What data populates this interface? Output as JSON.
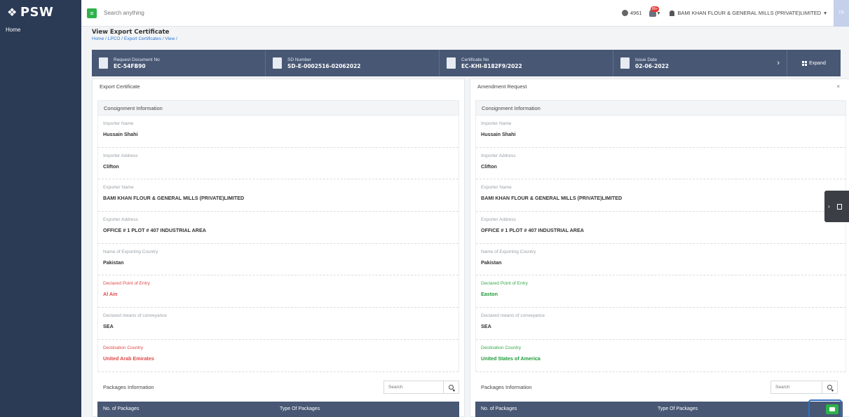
{
  "app": {
    "logo": "PSW",
    "nav_home": "Home"
  },
  "topbar": {
    "search_placeholder": "Search anything",
    "counter": "4961",
    "notification_count": "99+",
    "user_name": "BAMI KHAN FLOUR & GENERAL MILLS (PRIVATE)LIMITED",
    "avatar_initials": "TR"
  },
  "page": {
    "title": "View Export Certificate",
    "breadcrumb": "Home / LPCO / Export Certificates / View /"
  },
  "infobar": {
    "items": [
      {
        "label": "Request Document No",
        "value": "EC-54FB90"
      },
      {
        "label": "SD Number",
        "value": "SD-E-0002516-02062022"
      },
      {
        "label": "Certificate No",
        "value": "EC-KHI-8182F9/2022"
      },
      {
        "label": "Issue Date",
        "value": "02-06-2022"
      }
    ],
    "expand_label": "Expand"
  },
  "left_panel": {
    "title": "Export Certificate",
    "section": "Consignment Information",
    "fields": [
      {
        "label": "Importer Name",
        "value": "Hussain Shahi"
      },
      {
        "label": "Importer Address",
        "value": "Clifton"
      },
      {
        "label": "Exporter Name",
        "value": "BAMI KHAN FLOUR & GENERAL MILLS (PRIVATE)LIMITED"
      },
      {
        "label": "Exporter Address",
        "value": "OFFICE # 1 PLOT # 407 INDUSTRIAL AREA"
      },
      {
        "label": "Name of Exporting Country",
        "value": "Pakistan"
      },
      {
        "label": "Declared Point of Entry",
        "value": "Al Ain"
      },
      {
        "label": "Declared means of conveyance",
        "value": "SEA"
      },
      {
        "label": "Destination Country",
        "value": "United Arab Emirates"
      }
    ],
    "packages_title": "Packages Information",
    "search_placeholder": "Search",
    "columns": [
      "No. of Packages",
      "Type Of Packages"
    ]
  },
  "right_panel": {
    "title": "Amendment Request",
    "close": "×",
    "section": "Consignment Information",
    "fields": [
      {
        "label": "Importer Name",
        "value": "Hussain Shahi"
      },
      {
        "label": "Importer Address",
        "value": "Clifton"
      },
      {
        "label": "Exporter Name",
        "value": "BAMI KHAN FLOUR & GENERAL MILLS (PRIVATE)LIMITED"
      },
      {
        "label": "Exporter Address",
        "value": "OFFICE # 1 PLOT # 407 INDUSTRIAL AREA"
      },
      {
        "label": "Name of Exporting Country",
        "value": "Pakistan"
      },
      {
        "label": "Declared Point of Entry",
        "value": "Easton"
      },
      {
        "label": "Declared means of conveyance",
        "value": "SEA"
      },
      {
        "label": "Destination Country",
        "value": "United States of America"
      }
    ],
    "packages_title": "Packages Information",
    "search_placeholder": "Search",
    "columns": [
      "No. of Packages",
      "Type Of Packages"
    ]
  },
  "colors": {
    "sidebar": "#2b3a55",
    "infobar": "#475774",
    "changed_old": "#e04848",
    "changed_new": "#1f9b3b",
    "accent_green": "#2db24a"
  }
}
